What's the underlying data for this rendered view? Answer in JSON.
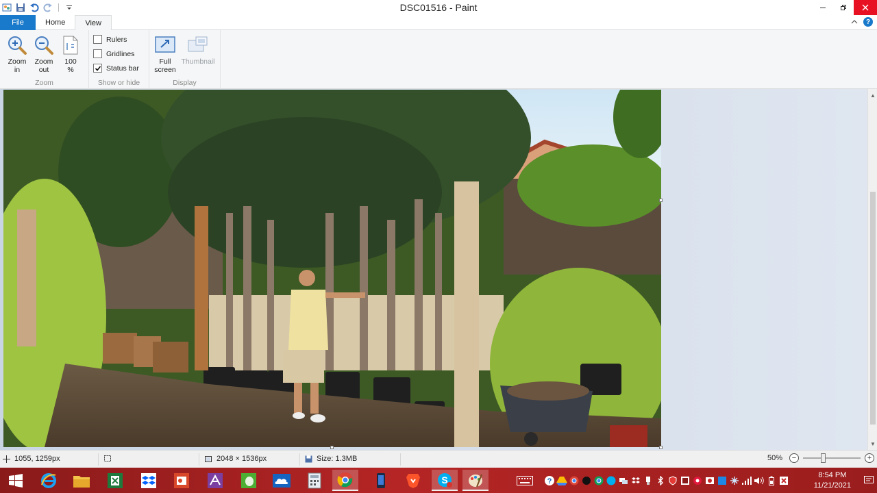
{
  "window": {
    "title": "DSC01516 - Paint",
    "minimize_icon": "minimize-icon",
    "restore_icon": "restore-icon",
    "close_icon": "close-icon"
  },
  "quick_access": [
    "paint-app-icon",
    "save-icon",
    "undo-icon",
    "redo-icon",
    "customize-dropdown-icon"
  ],
  "tabs": [
    {
      "label": "File",
      "active": false
    },
    {
      "label": "Home",
      "active": false
    },
    {
      "label": "View",
      "active": true
    }
  ],
  "ribbon": {
    "zoom_group": {
      "label": "Zoom",
      "zoom_in": "Zoom\nin",
      "zoom_out": "Zoom\nout",
      "hundred": "100\n%"
    },
    "show_hide_group": {
      "label": "Show or hide",
      "rulers": {
        "label": "Rulers",
        "checked": false
      },
      "gridlines": {
        "label": "Gridlines",
        "checked": false
      },
      "status_bar": {
        "label": "Status bar",
        "checked": true
      }
    },
    "display_group": {
      "label": "Display",
      "full_screen": "Full\nscreen",
      "thumbnail": "Thumbnail"
    }
  },
  "statusbar": {
    "cursor_position": "1055, 1259px",
    "selection_size": "",
    "image_size": "2048 × 1536px",
    "file_size": "Size: 1.3MB",
    "zoom": "50%",
    "zoom_level": 0.5
  },
  "taskbar": {
    "apps": [
      "windows-start-icon",
      "internet-explorer-icon",
      "file-explorer-icon",
      "excel-icon",
      "dropbox-icon",
      "office-icon",
      "visual-studio-icon",
      "evernote-icon",
      "onedrive-icon",
      "calculator-icon",
      "chrome-icon",
      "mobile-device-icon",
      "brave-icon",
      "skype-icon",
      "paint-icon"
    ],
    "clock_time": "8:54 PM",
    "clock_date": "11/21/2021"
  },
  "colors": {
    "file_tab": "#1979ca",
    "taskbar": "#a52222",
    "close_button": "#e81123"
  }
}
